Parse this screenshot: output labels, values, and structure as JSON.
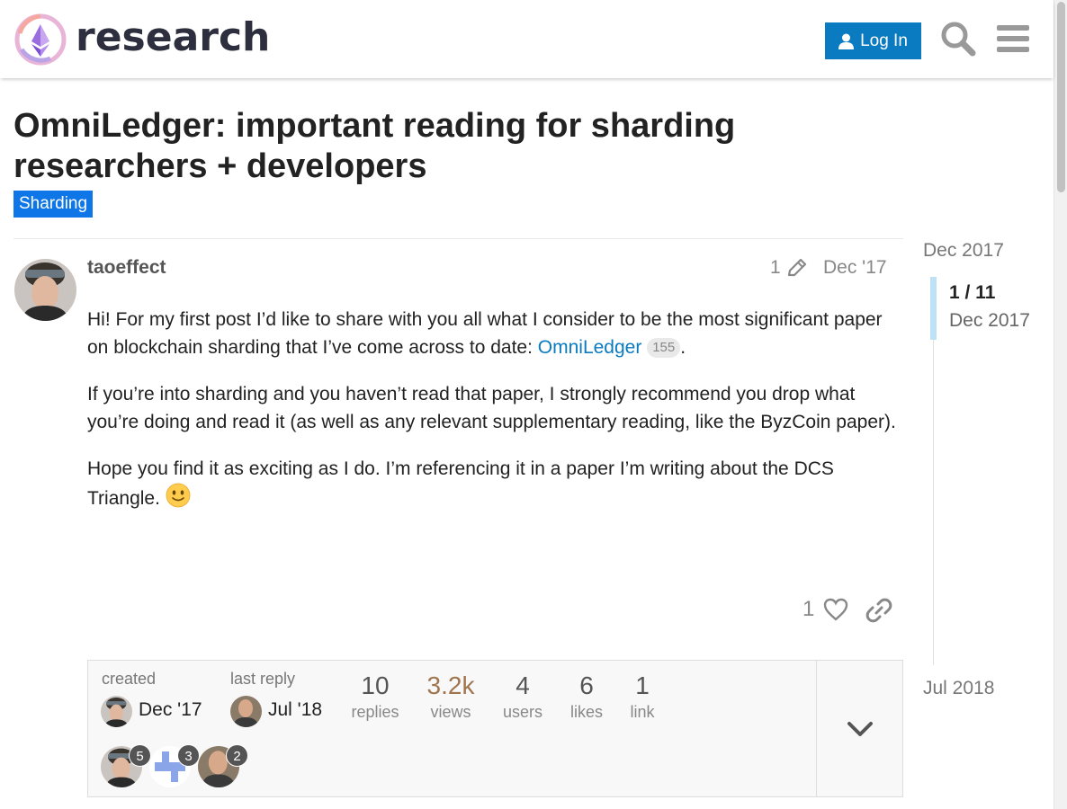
{
  "header": {
    "logo_text": "research",
    "login_label": "Log In",
    "search_icon": "search-icon",
    "menu_icon": "hamburger-menu-icon"
  },
  "topic": {
    "title": "OmniLedger: important reading for sharding researchers + developers",
    "category": "Sharding",
    "category_color": "#0e76e6"
  },
  "post": {
    "username": "taoeffect",
    "edit_count": "1",
    "date": "Dec '17",
    "p1_text": "Hi! For my first post I’d like to share with you all what I consider to be the most significant paper on blockchain sharding that I’ve come across to date: ",
    "p1_link": "OmniLedger",
    "p1_link_clicks": "155",
    "p1_end": ".",
    "p2_text": "If you’re into sharding and you haven’t read that paper, I strongly recommend you drop what you’re doing and read it (as well as any relevant supplementary reading, like the ByzCoin paper).",
    "p3_text": "Hope you find it as exciting as I do. I’m referencing it in a paper I’m writing about the DCS Triangle. ",
    "like_count": "1"
  },
  "topic_map": {
    "created_label": "created",
    "created_date": "Dec '17",
    "last_reply_label": "last reply",
    "last_reply_date": "Jul '18",
    "stats": [
      {
        "value": "10",
        "label": "replies"
      },
      {
        "value": "3.2k",
        "label": "views"
      },
      {
        "value": "4",
        "label": "users"
      },
      {
        "value": "6",
        "label": "likes"
      },
      {
        "value": "1",
        "label": "link"
      }
    ],
    "participants": [
      {
        "count": "5"
      },
      {
        "count": "3"
      },
      {
        "count": "2"
      }
    ]
  },
  "timeline": {
    "start": "Dec 2017",
    "position": "1 / 11",
    "position_date": "Dec 2017",
    "end": "Jul 2018"
  },
  "colors": {
    "accent": "#0a7ac1",
    "views_highlight": "#a0744d"
  }
}
